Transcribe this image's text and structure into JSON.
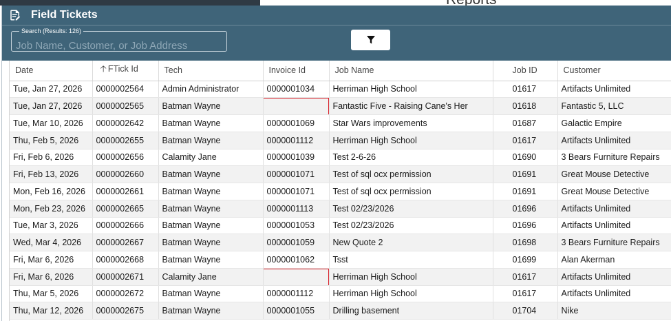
{
  "background": {
    "heading_fragment": "Reports"
  },
  "window": {
    "title": "Field Tickets",
    "title_icon": "edit-document-icon"
  },
  "search": {
    "legend": "Search (Results: 126)",
    "placeholder": "Job Name, Customer, or Job Address",
    "value": "",
    "filter_icon": "filter-funnel-icon"
  },
  "table": {
    "columns": [
      {
        "key": "date",
        "label": "Date"
      },
      {
        "key": "ftick_id",
        "label": "FTick Id",
        "sorted": "asc"
      },
      {
        "key": "tech",
        "label": "Tech"
      },
      {
        "key": "invoice_id",
        "label": "Invoice Id"
      },
      {
        "key": "job_name",
        "label": "Job Name"
      },
      {
        "key": "job_id",
        "label": "Job ID"
      },
      {
        "key": "customer",
        "label": "Customer"
      }
    ],
    "rows": [
      {
        "date": "Tue, Jan 27, 2026",
        "ftick_id": "0000002564",
        "tech": "Admin Administrator",
        "invoice_id": "0000001034",
        "job_name": "Herriman High School",
        "job_id": "01617",
        "customer": "Artifacts Unlimited",
        "highlighted": false
      },
      {
        "date": "Tue, Jan 27, 2026",
        "ftick_id": "0000002565",
        "tech": "Batman Wayne",
        "invoice_id": "",
        "job_name": "Fantastic Five - Raising Cane's Her",
        "job_id": "01618",
        "customer": "Fantastic 5, LLC",
        "highlighted": true
      },
      {
        "date": "Tue, Mar 10, 2026",
        "ftick_id": "0000002642",
        "tech": "Batman Wayne",
        "invoice_id": "0000001069",
        "job_name": "Star Wars improvements",
        "job_id": "01687",
        "customer": "Galactic Empire",
        "highlighted": false
      },
      {
        "date": "Thu, Feb 5, 2026",
        "ftick_id": "0000002655",
        "tech": "Batman Wayne",
        "invoice_id": "0000001112",
        "job_name": "Herriman High School",
        "job_id": "01617",
        "customer": "Artifacts Unlimited",
        "highlighted": false
      },
      {
        "date": "Fri, Feb 6, 2026",
        "ftick_id": "0000002656",
        "tech": "Calamity Jane",
        "invoice_id": "0000001039",
        "job_name": "Test 2-6-26",
        "job_id": "01690",
        "customer": "3 Bears Furniture Repairs",
        "highlighted": false
      },
      {
        "date": "Fri, Feb 13, 2026",
        "ftick_id": "0000002660",
        "tech": "Batman Wayne",
        "invoice_id": "0000001071",
        "job_name": "Test of sql ocx permission",
        "job_id": "01691",
        "customer": "Great Mouse Detective",
        "highlighted": false
      },
      {
        "date": "Mon, Feb 16, 2026",
        "ftick_id": "0000002661",
        "tech": "Batman Wayne",
        "invoice_id": "0000001071",
        "job_name": "Test of sql ocx permission",
        "job_id": "01691",
        "customer": "Great Mouse Detective",
        "highlighted": false
      },
      {
        "date": "Mon, Feb 23, 2026",
        "ftick_id": "0000002665",
        "tech": "Batman Wayne",
        "invoice_id": "0000001113",
        "job_name": "Test 02/23/2026",
        "job_id": "01696",
        "customer": "Artifacts Unlimited",
        "highlighted": false
      },
      {
        "date": "Tue, Mar 3, 2026",
        "ftick_id": "0000002666",
        "tech": "Batman Wayne",
        "invoice_id": "0000001053",
        "job_name": "Test 02/23/2026",
        "job_id": "01696",
        "customer": "Artifacts Unlimited",
        "highlighted": false
      },
      {
        "date": "Wed, Mar 4, 2026",
        "ftick_id": "0000002667",
        "tech": "Batman Wayne",
        "invoice_id": "0000001059",
        "job_name": "New Quote 2",
        "job_id": "01698",
        "customer": "3 Bears Furniture Repairs",
        "highlighted": false
      },
      {
        "date": "Fri, Mar 6, 2026",
        "ftick_id": "0000002668",
        "tech": "Batman Wayne",
        "invoice_id": "0000001062",
        "job_name": "Tsst",
        "job_id": "01699",
        "customer": "Alan Akerman",
        "highlighted": false
      },
      {
        "date": "Fri, Mar 6, 2026",
        "ftick_id": "0000002671",
        "tech": "Calamity Jane",
        "invoice_id": "",
        "job_name": "Herriman High School",
        "job_id": "01617",
        "customer": "Artifacts Unlimited",
        "highlighted": true
      },
      {
        "date": "Thu, Mar 5, 2026",
        "ftick_id": "0000002672",
        "tech": "Batman Wayne",
        "invoice_id": "0000001112",
        "job_name": "Herriman High School",
        "job_id": "01617",
        "customer": "Artifacts Unlimited",
        "highlighted": false
      },
      {
        "date": "Thu, Mar 12, 2026",
        "ftick_id": "0000002675",
        "tech": "Batman Wayne",
        "invoice_id": "0000001055",
        "job_name": "Drilling basement",
        "job_id": "01704",
        "customer": "Nike",
        "highlighted": false
      }
    ]
  },
  "colors": {
    "header_bar": "#3f6479",
    "highlight_border": "#d9202a",
    "row_stripe": "#f2f2f2"
  }
}
